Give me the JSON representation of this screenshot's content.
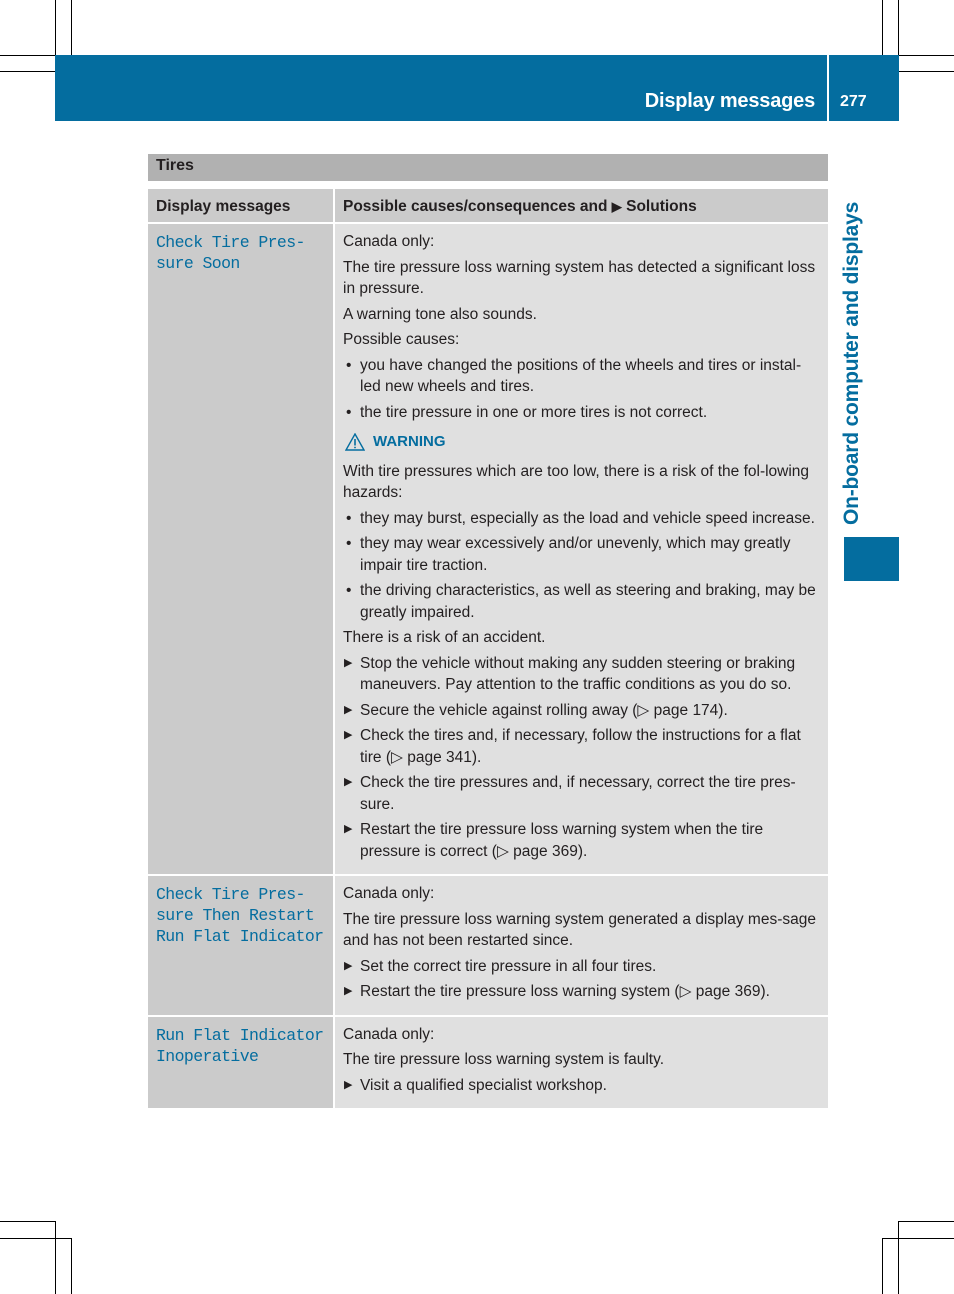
{
  "header": {
    "section_title": "Display messages",
    "page_number": "277",
    "accent_color": "#046d9f"
  },
  "side_tab": {
    "label": "On-board computer and displays"
  },
  "section": {
    "title": "Tires"
  },
  "table": {
    "columns": [
      "Display messages",
      "Possible causes/consequences and",
      "Solutions"
    ],
    "rows": [
      {
        "message": "Check Tire Pres-\nsure Soon",
        "intro": [
          "Canada only:",
          "The tire pressure loss warning system has detected a significant loss in pressure.",
          "A warning tone also sounds.",
          "Possible causes:"
        ],
        "causes": [
          "you have changed the positions of the wheels and tires or instal-led new wheels and tires.",
          "the tire pressure in one or more tires is not correct."
        ],
        "warning_label": "WARNING",
        "warning_text": "With tire pressures which are too low, there is a risk of the fol-lowing hazards:",
        "hazards": [
          "they may burst, especially as the load and vehicle speed increase.",
          "they may wear excessively and/or unevenly, which may greatly impair tire traction.",
          "the driving characteristics, as well as steering and braking, may be greatly impaired."
        ],
        "risk": "There is a risk of an accident.",
        "actions": [
          "Stop the vehicle without making any sudden steering or braking maneuvers. Pay attention to the traffic conditions as you do so.",
          "Secure the vehicle against rolling away (▷ page 174).",
          "Check the tires and, if necessary, follow the instructions for a flat tire (▷ page 341).",
          "Check the tire pressures and, if necessary, correct the tire pres-sure.",
          "Restart the tire pressure loss warning system when the tire pressure is correct (▷ page 369)."
        ]
      },
      {
        "message": "Check Tire Pres-\nsure Then Restart\nRun Flat Indicator",
        "intro": [
          "Canada only:",
          "The tire pressure loss warning system generated a display mes-sage and has not been restarted since."
        ],
        "actions": [
          "Set the correct tire pressure in all four tires.",
          "Restart the tire pressure loss warning system (▷ page 369)."
        ]
      },
      {
        "message": "Run Flat Indicator\nInoperative",
        "intro": [
          "Canada only:",
          "The tire pressure loss warning system is faulty."
        ],
        "actions": [
          "Visit a qualified specialist workshop."
        ]
      }
    ]
  }
}
